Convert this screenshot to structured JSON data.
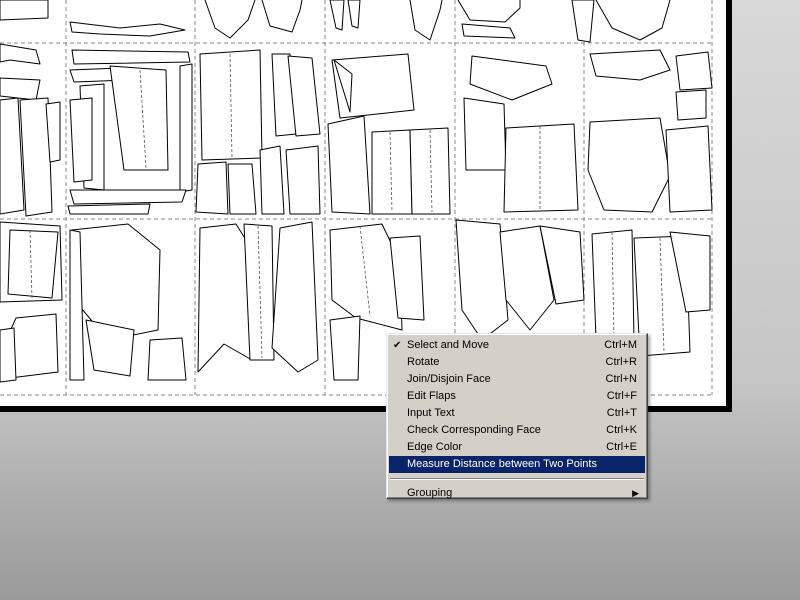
{
  "context_menu": {
    "items": [
      {
        "label": "Select and Move",
        "shortcut": "Ctrl+M",
        "checked": true
      },
      {
        "label": "Rotate",
        "shortcut": "Ctrl+R"
      },
      {
        "label": "Join/Disjoin Face",
        "shortcut": "Ctrl+N"
      },
      {
        "label": "Edit Flaps",
        "shortcut": "Ctrl+F"
      },
      {
        "label": "Input Text",
        "shortcut": "Ctrl+T"
      },
      {
        "label": "Check Corresponding Face",
        "shortcut": "Ctrl+K"
      },
      {
        "label": "Edge Color",
        "shortcut": "Ctrl+E"
      },
      {
        "label": "Measure Distance between Two Points",
        "shortcut": "",
        "highlighted": true
      }
    ],
    "submenu": {
      "label": "Grouping"
    },
    "check_icon": "checkmark-icon",
    "submenu_icon": "submenu-arrow-icon",
    "highlight_color": "#0a246a",
    "menu_bg": "#d4d0c8"
  },
  "canvas": {
    "content": "papercraft unfolded parts sheet",
    "sheet_bg": "#ffffff",
    "workspace_bg": "#b0b0b0"
  }
}
